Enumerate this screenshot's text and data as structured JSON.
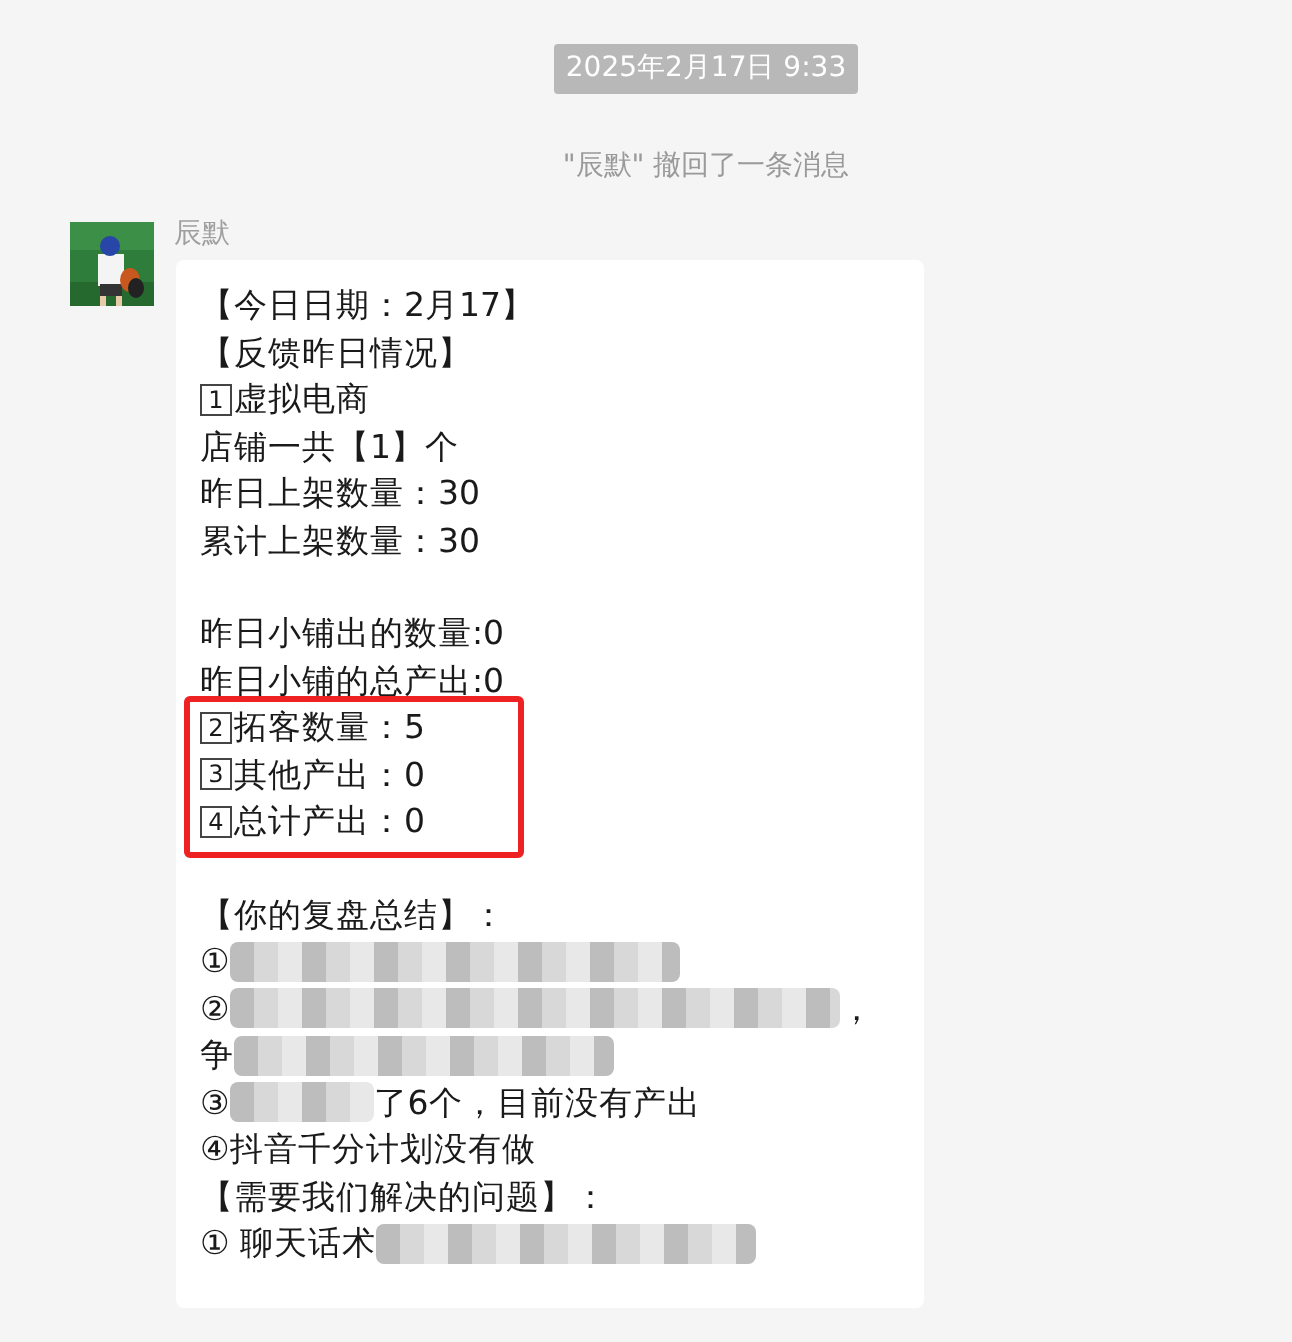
{
  "timestamp": "2025年2月17日 9:33",
  "system_notice": "\"辰默\" 撤回了一条消息",
  "message": {
    "sender": "辰默",
    "lines": [
      {
        "kind": "text",
        "text": "【今日日期：2月17】"
      },
      {
        "kind": "text",
        "text": "【反馈昨日情况】"
      },
      {
        "kind": "numbered",
        "num": "1",
        "text": "虚拟电商"
      },
      {
        "kind": "text",
        "text": "店铺一共【1】个"
      },
      {
        "kind": "text",
        "text": "昨日上架数量：30"
      },
      {
        "kind": "text",
        "text": "累计上架数量：30"
      },
      {
        "kind": "blank"
      },
      {
        "kind": "text",
        "text": "昨日小铺出的数量:0"
      },
      {
        "kind": "text",
        "text": "昨日小铺的总产出:0"
      },
      {
        "kind": "boxed",
        "lines": [
          {
            "kind": "numbered",
            "num": "2",
            "text": "拓客数量：5"
          },
          {
            "kind": "numbered",
            "num": "3",
            "text": "其他产出：0"
          },
          {
            "kind": "numbered",
            "num": "4",
            "text": "总计产出：0"
          }
        ]
      },
      {
        "kind": "blank"
      },
      {
        "kind": "text",
        "text": "【你的复盘总结】："
      },
      {
        "kind": "mixed",
        "segments": [
          {
            "kind": "text",
            "text": "①"
          },
          {
            "kind": "mosaic_long"
          }
        ]
      },
      {
        "kind": "mixed",
        "segments": [
          {
            "kind": "text",
            "text": "②"
          },
          {
            "kind": "mosaic_full"
          },
          {
            "kind": "text",
            "text": "，"
          }
        ]
      },
      {
        "kind": "mixed",
        "segments": [
          {
            "kind": "text",
            "text": "争"
          },
          {
            "kind": "mosaic_medium"
          }
        ]
      },
      {
        "kind": "mixed",
        "segments": [
          {
            "kind": "text",
            "text": "③"
          },
          {
            "kind": "mosaic_short"
          },
          {
            "kind": "text",
            "text": "了6个，目前没有产出"
          }
        ]
      },
      {
        "kind": "text",
        "text": "④抖音千分计划没有做"
      },
      {
        "kind": "text",
        "text": "【需要我们解决的问题】："
      },
      {
        "kind": "mixed",
        "segments": [
          {
            "kind": "text",
            "text": "① 聊天话术"
          },
          {
            "kind": "mosaic_medium"
          }
        ]
      }
    ]
  }
}
